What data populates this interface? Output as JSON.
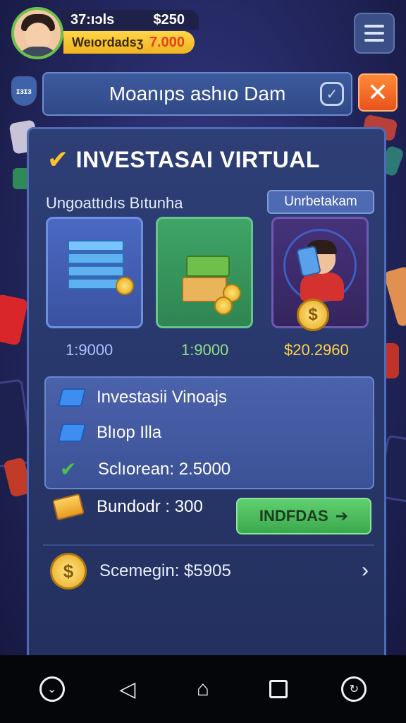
{
  "header": {
    "stat_left": "37:ıɔls",
    "stat_right": "$250",
    "wallet_label": "Weıordadsʒ",
    "wallet_value": "7.000"
  },
  "top_bar": {
    "badge": "ɪɜɪɜ",
    "title": "Moanıps ashıo Dam"
  },
  "panel": {
    "title": "INVESTASAI VIRTUAL",
    "subtitle": "Ungoattıdıs Bıtunha",
    "sub_button": "Unrbetakam",
    "cards": [
      {
        "name": "data-blocks",
        "price": "1:9000"
      },
      {
        "name": "cash-box",
        "price": "1:9000"
      },
      {
        "name": "trader-portrait",
        "price": "$20.2960"
      }
    ],
    "info": {
      "row1": "Investasii Vinoajs",
      "row2": "Blıop Illa",
      "row3": "Sclıorean: 2.5000"
    },
    "bundle_label": "Bundodr : 300",
    "invest_button": "INDFDAS",
    "bonus_label": "Scemegin: $5905"
  },
  "colors": {
    "accent_gold": "#ffc32a",
    "accent_green": "#4ec04c",
    "panel_blue": "#2e3f76",
    "close_orange": "#ff8a38"
  },
  "icons": {
    "menu": "hamburger-icon",
    "close": "close-icon",
    "check": "check-icon",
    "coin": "coin-icon",
    "chevron": "chevron-right-icon"
  }
}
